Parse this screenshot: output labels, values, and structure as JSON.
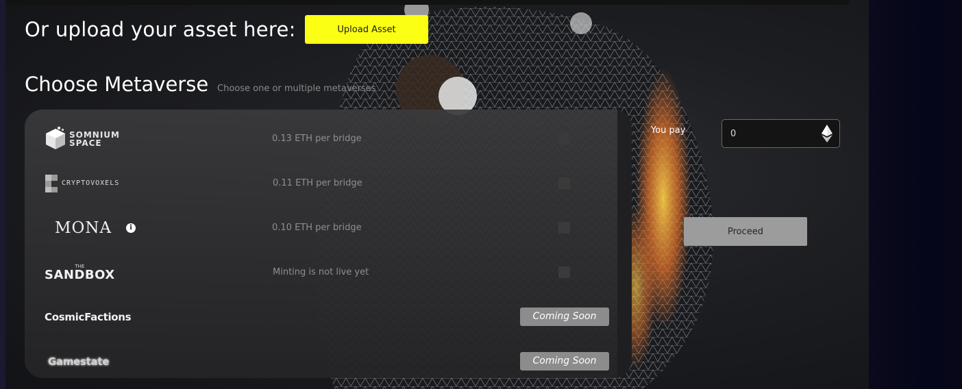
{
  "upload": {
    "title": "Or upload your asset here:",
    "button_label": "Upload Asset"
  },
  "metaverse": {
    "title": "Choose Metaverse",
    "subtitle": "Choose one or multiple metaverses"
  },
  "rows": [
    {
      "logo_text_1": "SOMNIUM",
      "logo_text_2": "SPACE",
      "price": "0.13 ETH per bridge",
      "checked": false
    },
    {
      "logo_text": "CRYPTOVOXELS",
      "price": "0.11 ETH per bridge",
      "checked": false
    },
    {
      "logo_text": "MONA",
      "price": "0.10 ETH per bridge",
      "info_icon": "i",
      "checked": false
    },
    {
      "logo_text_small": "THE",
      "logo_text": "SANDBOX",
      "price": "Minting is not live yet",
      "checked": false
    },
    {
      "logo_text": "CosmicFactions",
      "badge": "Coming Soon"
    },
    {
      "logo_text": "Gamestate",
      "badge": "Coming Soon"
    }
  ],
  "payment": {
    "label": "You pay",
    "value": "0",
    "currency_icon": "ethereum-icon"
  },
  "proceed_label": "Proceed",
  "colors": {
    "accent": "#fbff14",
    "panel": "#2e2e30",
    "badge": "#8c8c8c"
  }
}
